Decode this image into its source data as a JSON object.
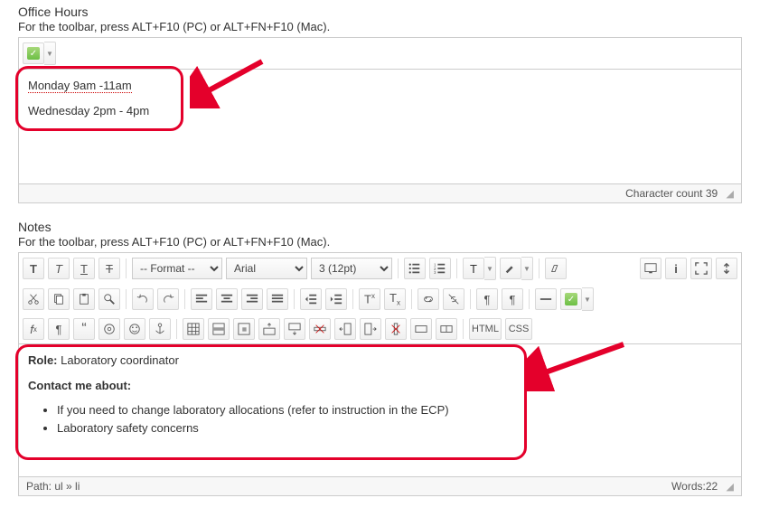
{
  "officeHours": {
    "label": "Office Hours",
    "hint": "For the toolbar, press ALT+F10 (PC) or ALT+FN+F10 (Mac).",
    "line1": "Monday 9am -11am",
    "line2": "Wednesday 2pm - 4pm",
    "charCountLabel": "Character count 39"
  },
  "notes": {
    "label": "Notes",
    "hint": "For the toolbar, press ALT+F10 (PC) or ALT+FN+F10 (Mac).",
    "selects": {
      "format": "-- Format --",
      "font": "Arial",
      "size": "3 (12pt)"
    },
    "content": {
      "roleLabel": "Role:",
      "roleValue": " Laboratory coordinator",
      "contactHeading": "Contact me about:",
      "item1": "If you need to change laboratory allocations (refer to instruction in the ECP)",
      "item2": "Laboratory safety concerns"
    },
    "pathPrefix": "Path: ",
    "pathUl": "ul",
    "pathSep": " » ",
    "pathLi": "li",
    "wordsLabel": "Words:22",
    "htmlLabel": "HTML",
    "cssLabel": "CSS"
  }
}
